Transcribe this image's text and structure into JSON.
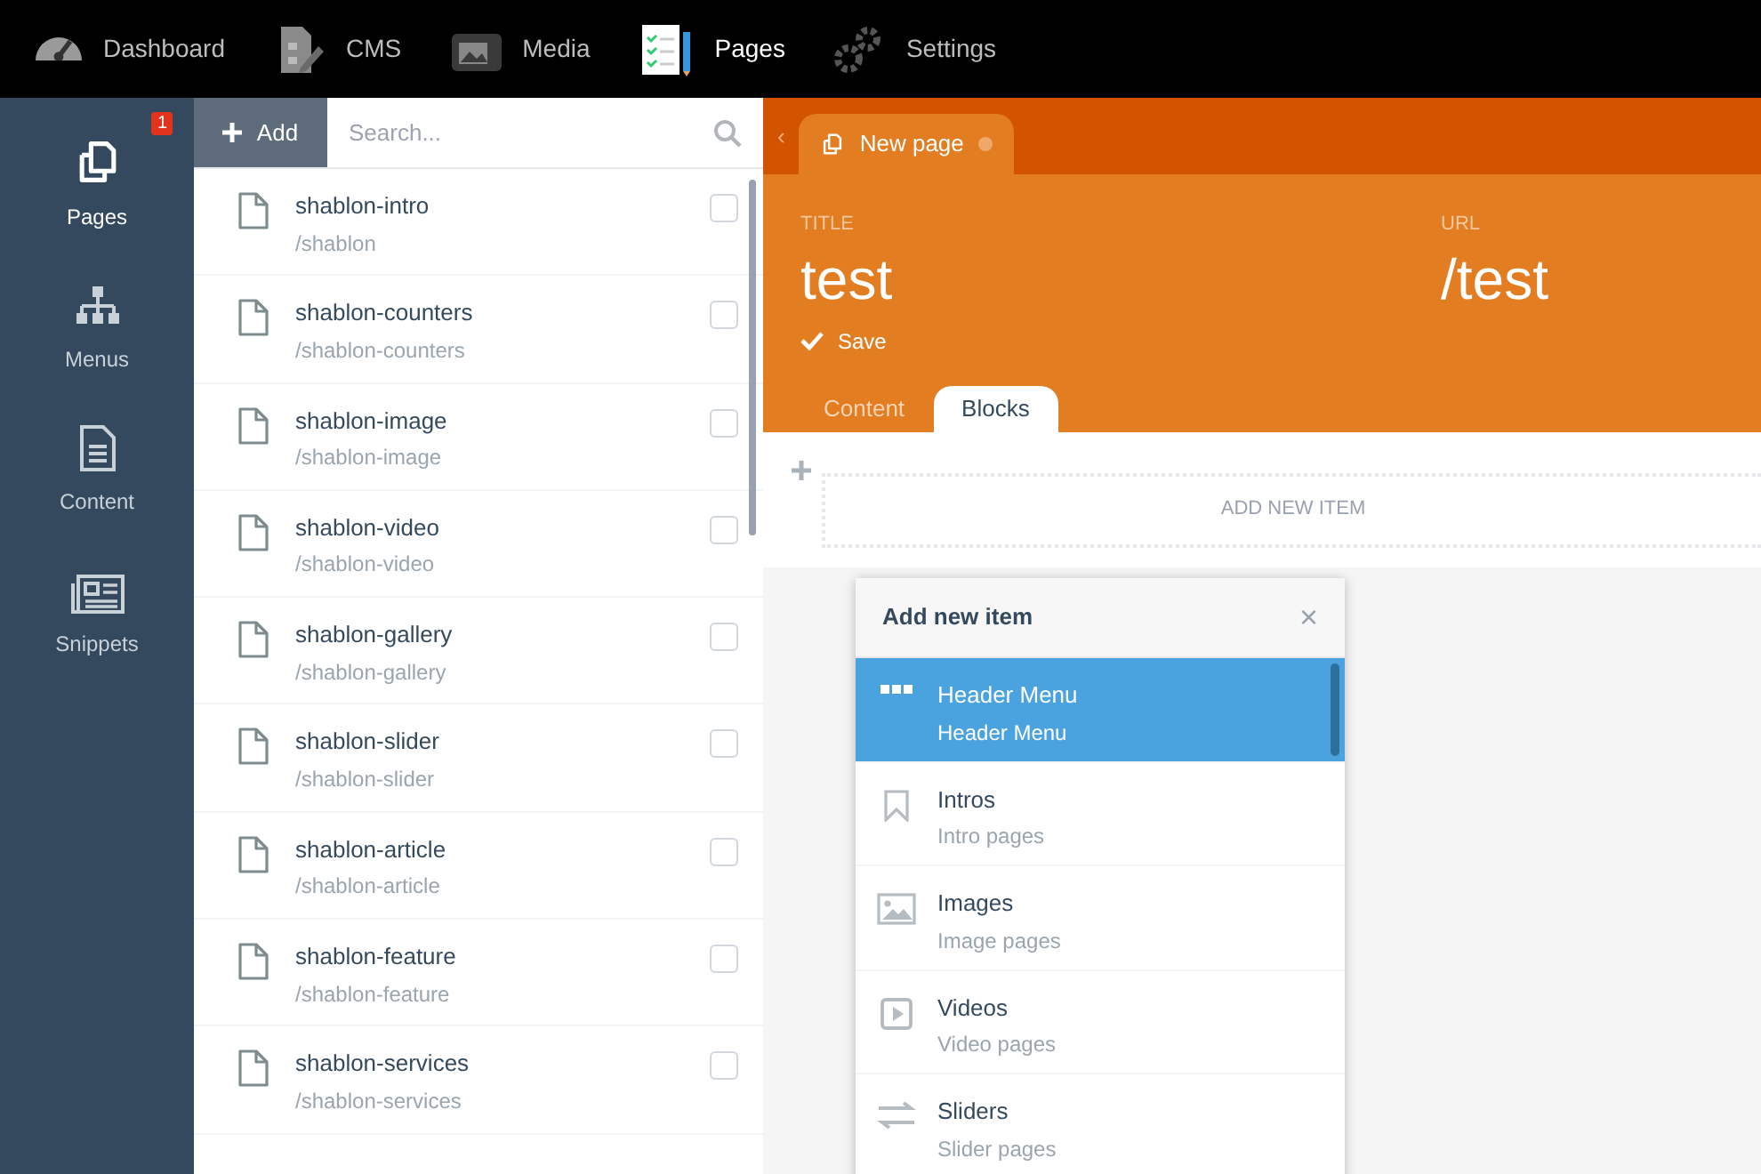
{
  "top_nav": [
    {
      "label": "Dashboard",
      "kind": "gauge",
      "selected": false
    },
    {
      "label": "CMS",
      "kind": "cms",
      "selected": false
    },
    {
      "label": "Media",
      "kind": "media",
      "selected": false
    },
    {
      "label": "Pages",
      "kind": "pages",
      "selected": true
    },
    {
      "label": "Settings",
      "kind": "gears",
      "selected": false
    }
  ],
  "sidebar": {
    "items": [
      {
        "label": "Pages",
        "kind": "pages",
        "selected": true,
        "badge": "1"
      },
      {
        "label": "Menus",
        "kind": "tree",
        "selected": false
      },
      {
        "label": "Content",
        "kind": "doc",
        "selected": false
      },
      {
        "label": "Snippets",
        "kind": "news",
        "selected": false
      }
    ]
  },
  "page_list": {
    "add_button": "Add",
    "search": {
      "placeholder": "Search..."
    },
    "items": [
      {
        "title": "shablon-intro",
        "path": "/shablon",
        "checked": false
      },
      {
        "title": "shablon-counters",
        "path": "/shablon-counters",
        "checked": false
      },
      {
        "title": "shablon-image",
        "path": "/shablon-image",
        "checked": false
      },
      {
        "title": "shablon-video",
        "path": "/shablon-video",
        "checked": false
      },
      {
        "title": "shablon-gallery",
        "path": "/shablon-gallery",
        "checked": false
      },
      {
        "title": "shablon-slider",
        "path": "/shablon-slider",
        "checked": false
      },
      {
        "title": "shablon-article",
        "path": "/shablon-article",
        "checked": false
      },
      {
        "title": "shablon-feature",
        "path": "/shablon-feature",
        "checked": false
      },
      {
        "title": "shablon-services",
        "path": "/shablon-services",
        "checked": false
      }
    ]
  },
  "editor": {
    "back": "‹",
    "tab": {
      "label": "New page"
    },
    "title_label": "TITLE",
    "title": "test",
    "url_label": "URL",
    "url": "/test",
    "save": "Save",
    "tabs": [
      {
        "label": "Content",
        "selected": false
      },
      {
        "label": "Blocks",
        "selected": true
      }
    ],
    "add_new_item": "ADD NEW ITEM"
  },
  "popup": {
    "title": "Add new item",
    "close": "×",
    "items": [
      {
        "title": "Header Menu",
        "subtitle": "Header Menu",
        "kind": "dots",
        "selected": true
      },
      {
        "title": "Intros",
        "subtitle": "Intro pages",
        "kind": "bookmark",
        "selected": false
      },
      {
        "title": "Images",
        "subtitle": "Image pages",
        "kind": "image",
        "selected": false
      },
      {
        "title": "Videos",
        "subtitle": "Video pages",
        "kind": "video",
        "selected": false
      },
      {
        "title": "Sliders",
        "subtitle": "Slider pages",
        "kind": "arrows",
        "selected": false
      }
    ]
  }
}
